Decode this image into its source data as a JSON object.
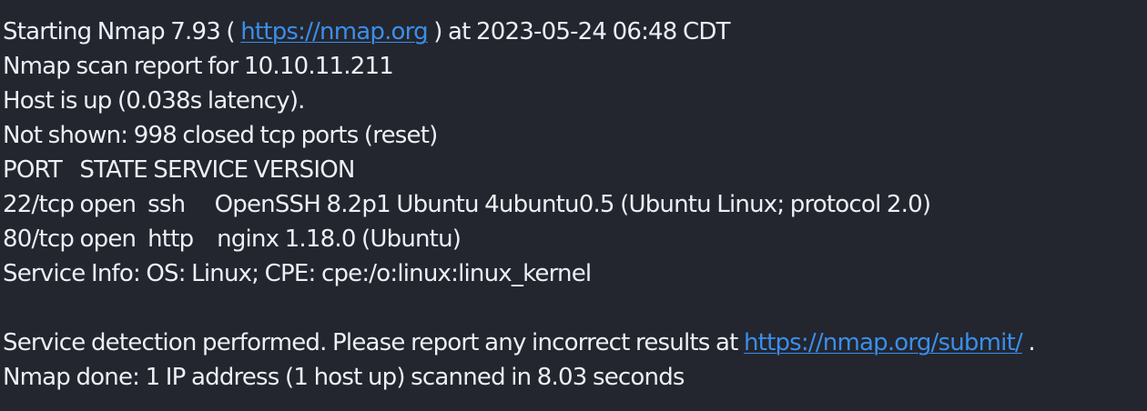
{
  "terminal": {
    "line1": {
      "prefix": "Starting Nmap 7.93 ( ",
      "link": "https://nmap.org",
      "suffix": " ) at 2023-05-24 06:48 CDT"
    },
    "line2": "Nmap scan report for 10.10.11.211",
    "line3": "Host is up (0.038s latency).",
    "line4": "Not shown: 998 closed tcp ports (reset)",
    "line5": "PORT   STATE SERVICE VERSION",
    "line6": "22/tcp open  ssh     OpenSSH 8.2p1 Ubuntu 4ubuntu0.5 (Ubuntu Linux; protocol 2.0)",
    "line7": "80/tcp open  http    nginx 1.18.0 (Ubuntu)",
    "line8": "Service Info: OS: Linux; CPE: cpe:/o:linux:linux_kernel",
    "line9": "",
    "line10": {
      "prefix": "Service detection performed. Please report any incorrect results at ",
      "link": "https://nmap.org/submit/",
      "suffix": " ."
    },
    "line11": "Nmap done: 1 IP address (1 host up) scanned in 8.03 seconds"
  },
  "colors": {
    "background": "#23262e",
    "text": "#eceff4",
    "link": "#3b8eea"
  }
}
